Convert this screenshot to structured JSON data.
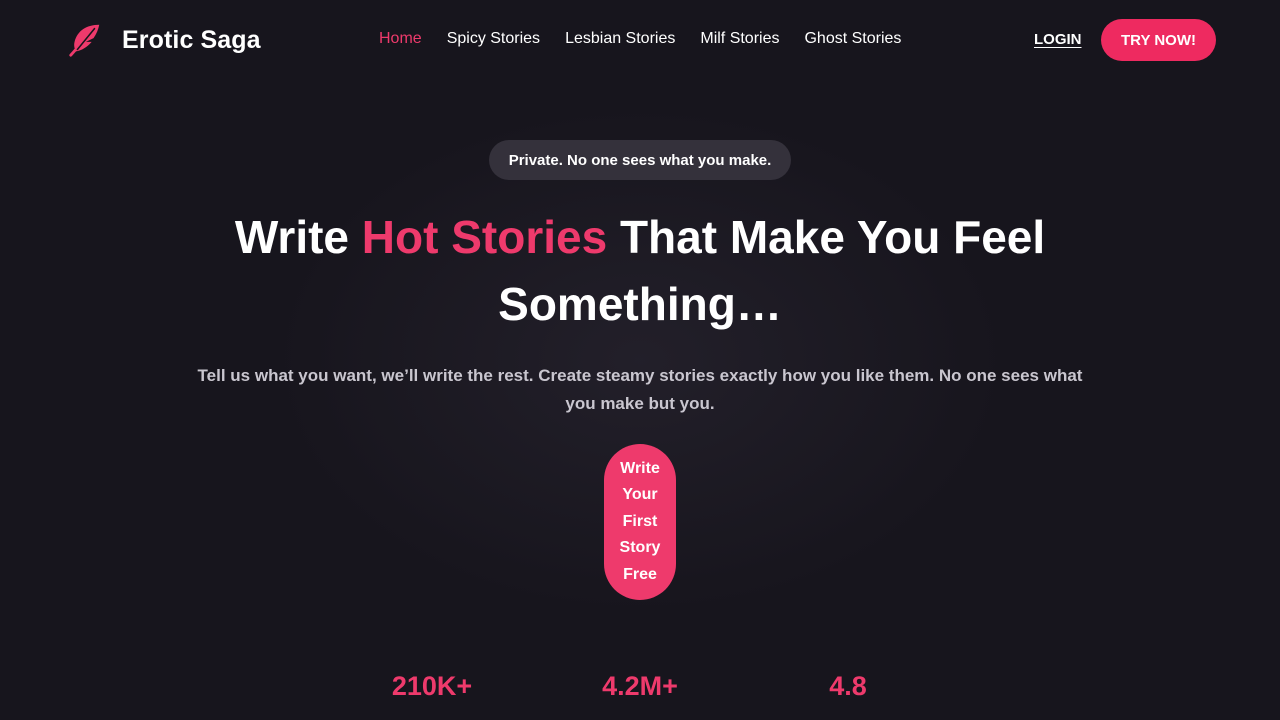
{
  "brand": {
    "name": "Erotic Saga",
    "logo_icon": "feather-icon",
    "accent_color": "#ee3a6c"
  },
  "nav": {
    "items": [
      {
        "label": "Home",
        "active": true
      },
      {
        "label": "Spicy Stories",
        "active": false
      },
      {
        "label": "Lesbian Stories",
        "active": false
      },
      {
        "label": "Milf Stories",
        "active": false
      },
      {
        "label": "Ghost Stories",
        "active": false
      }
    ],
    "login_label": "LOGIN",
    "try_label": "TRY NOW!"
  },
  "hero": {
    "badge": "Private. No one sees what you make.",
    "headline_part1": "Write ",
    "headline_accent": "Hot Stories",
    "headline_part2": " That Make You Feel Something…",
    "subtitle": "Tell us what you want, we’ll write the rest. Create steamy stories exactly how you like them. No one sees what you make but you.",
    "cta_label": "Write Your First Story Free"
  },
  "stats": [
    {
      "value": "210K+"
    },
    {
      "value": "4.2M+"
    },
    {
      "value": "4.8"
    }
  ]
}
